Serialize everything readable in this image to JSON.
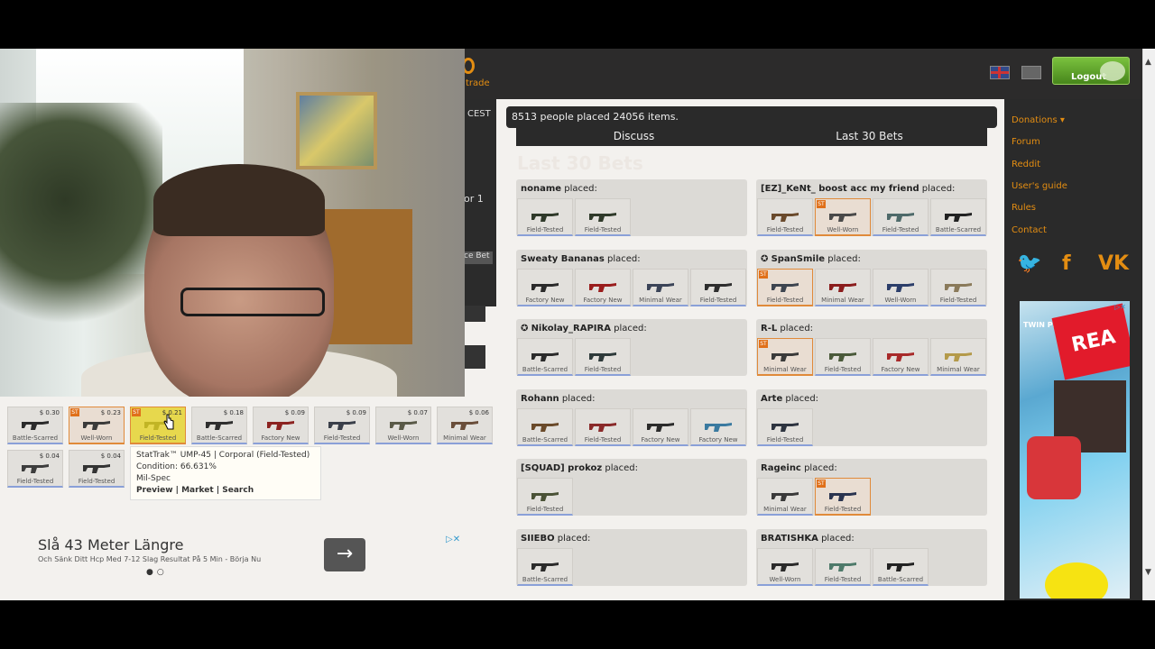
{
  "header": {
    "logo_text": "trade",
    "logout_label": "Logout"
  },
  "left_panel": {
    "timezone": "CEST",
    "partial_text": "or 1",
    "place_bet_label": "ce Bet"
  },
  "stats": {
    "summary": "8513 people placed 24056 items."
  },
  "tabs": [
    "Discuss",
    "Last 30 Bets"
  ],
  "section_heading": "Last 30 Bets",
  "my_items": [
    {
      "price": "$ 0.30",
      "condition": "Battle-Scarred",
      "st": false,
      "color": "#2b2b2b"
    },
    {
      "price": "$ 0.23",
      "condition": "Well-Worn",
      "st": true,
      "color": "#3b3b3b"
    },
    {
      "price": "$ 0.21",
      "condition": "Field-Tested",
      "st": true,
      "color": "#c2b525"
    },
    {
      "price": "$ 0.18",
      "condition": "Battle-Scarred",
      "st": false,
      "color": "#2e2e2e"
    },
    {
      "price": "$ 0.09",
      "condition": "Factory New",
      "st": false,
      "color": "#8c2320"
    },
    {
      "price": "$ 0.09",
      "condition": "Field-Tested",
      "st": false,
      "color": "#3a3f4a"
    },
    {
      "price": "$ 0.07",
      "condition": "Well-Worn",
      "st": false,
      "color": "#5a5a48"
    },
    {
      "price": "$ 0.06",
      "condition": "Minimal Wear",
      "st": false,
      "color": "#6a4e3a"
    },
    {
      "price": "$ 0.04",
      "condition": "Field-Tested",
      "st": false,
      "color": "#3d3d3d"
    },
    {
      "price": "$ 0.04",
      "condition": "Field-Tested",
      "st": false,
      "color": "#333333"
    }
  ],
  "tooltip": {
    "title": "StatTrak™ UMP-45 | Corporal (Field-Tested)",
    "condition": "Condition: 66.631%",
    "rarity": "Mil-Spec",
    "link_preview": "Preview",
    "sep1": " | ",
    "link_market": "Market",
    "sep2": " | ",
    "link_search": "Search"
  },
  "ad": {
    "title": "Slå 43 Meter Längre",
    "subtitle": "Och Sänk Ditt Hcp Med 7-12 Slag Resultat På 5 Min - Börja Nu",
    "arrow": "→",
    "choices": "▷✕",
    "dots": "●○"
  },
  "placed_suffix": "placed:",
  "bets": [
    {
      "user": "noname",
      "items": [
        {
          "cond": "Field-Tested",
          "st": false,
          "color": "#2f3a2a"
        },
        {
          "cond": "Field-Tested",
          "st": false,
          "color": "#2f3a2a"
        }
      ]
    },
    {
      "user": "[EZ]_KeNt_ boost acc my friend",
      "items": [
        {
          "cond": "Field-Tested",
          "st": false,
          "color": "#6a4a2c"
        },
        {
          "cond": "Well-Worn",
          "st": true,
          "color": "#4a4a4a"
        },
        {
          "cond": "Field-Tested",
          "st": false,
          "color": "#4e6a6a"
        },
        {
          "cond": "Battle-Scarred",
          "st": false,
          "color": "#222222"
        }
      ]
    },
    {
      "user": "Sweaty Bananas",
      "items": [
        {
          "cond": "Factory New",
          "st": false,
          "color": "#2b2b2b"
        },
        {
          "cond": "Factory New",
          "st": false,
          "color": "#9a1d1d"
        },
        {
          "cond": "Minimal Wear",
          "st": false,
          "color": "#3b4458"
        },
        {
          "cond": "Field-Tested",
          "st": false,
          "color": "#2e2e2e"
        }
      ]
    },
    {
      "user": "SpanSmile",
      "icon": true,
      "items": [
        {
          "cond": "Field-Tested",
          "st": true,
          "color": "#3e4550"
        },
        {
          "cond": "Minimal Wear",
          "st": false,
          "color": "#8b1d1d"
        },
        {
          "cond": "Well-Worn",
          "st": false,
          "color": "#2c3e6a"
        },
        {
          "cond": "Field-Tested",
          "st": false,
          "color": "#8a7a5a"
        }
      ]
    },
    {
      "user": "Nikolay_RAPIRA",
      "icon": true,
      "items": [
        {
          "cond": "Battle-Scarred",
          "st": false,
          "color": "#2b2b2b"
        },
        {
          "cond": "Field-Tested",
          "st": false,
          "color": "#2e3a3a"
        }
      ]
    },
    {
      "user": "R-L",
      "items": [
        {
          "cond": "Minimal Wear",
          "st": true,
          "color": "#3a3a3a"
        },
        {
          "cond": "Field-Tested",
          "st": false,
          "color": "#4a5a3a"
        },
        {
          "cond": "Factory New",
          "st": false,
          "color": "#a82a2a"
        },
        {
          "cond": "Minimal Wear",
          "st": false,
          "color": "#b49a4a"
        }
      ]
    },
    {
      "user": "Rohann",
      "items": [
        {
          "cond": "Battle-Scarred",
          "st": false,
          "color": "#6a4a2a"
        },
        {
          "cond": "Field-Tested",
          "st": false,
          "color": "#8a2a2a"
        },
        {
          "cond": "Factory New",
          "st": false,
          "color": "#2b2b2b"
        },
        {
          "cond": "Factory New",
          "st": false,
          "color": "#3a7aa0"
        }
      ]
    },
    {
      "user": "Arte",
      "items": [
        {
          "cond": "Field-Tested",
          "st": false,
          "color": "#2e3440"
        }
      ]
    },
    {
      "user": "[SQUAD] prokoz",
      "items": [
        {
          "cond": "Field-Tested",
          "st": false,
          "color": "#4a5236"
        }
      ]
    },
    {
      "user": "Rageinc",
      "items": [
        {
          "cond": "Minimal Wear",
          "st": false,
          "color": "#3a3a3a"
        },
        {
          "cond": "Field-Tested",
          "st": true,
          "color": "#2a3450"
        }
      ]
    },
    {
      "user": "SIIEBO",
      "items": [
        {
          "cond": "Battle-Scarred",
          "st": false,
          "color": "#2b2b2b"
        }
      ]
    },
    {
      "user": "BRATISHKA",
      "items": [
        {
          "cond": "Well-Worn",
          "st": false,
          "color": "#2b2b2b"
        },
        {
          "cond": "Field-Tested",
          "st": false,
          "color": "#4e7a6a"
        },
        {
          "cond": "Battle-Scarred",
          "st": false,
          "color": "#222222"
        }
      ]
    }
  ],
  "st_label": "ST",
  "sidebar": {
    "donations": "Donations ▾",
    "forum": "Forum",
    "reddit": "Reddit",
    "users_guide": "User's guide",
    "rules": "Rules",
    "contact": "Contact",
    "twitter_glyph": "🐦",
    "facebook_glyph": "f",
    "vk_glyph": "VK"
  },
  "side_ad": {
    "text": "TWIN PEAKS",
    "tag": "REA",
    "close": "▷✕"
  },
  "scroll": {
    "up": "▲",
    "down": "▼"
  }
}
